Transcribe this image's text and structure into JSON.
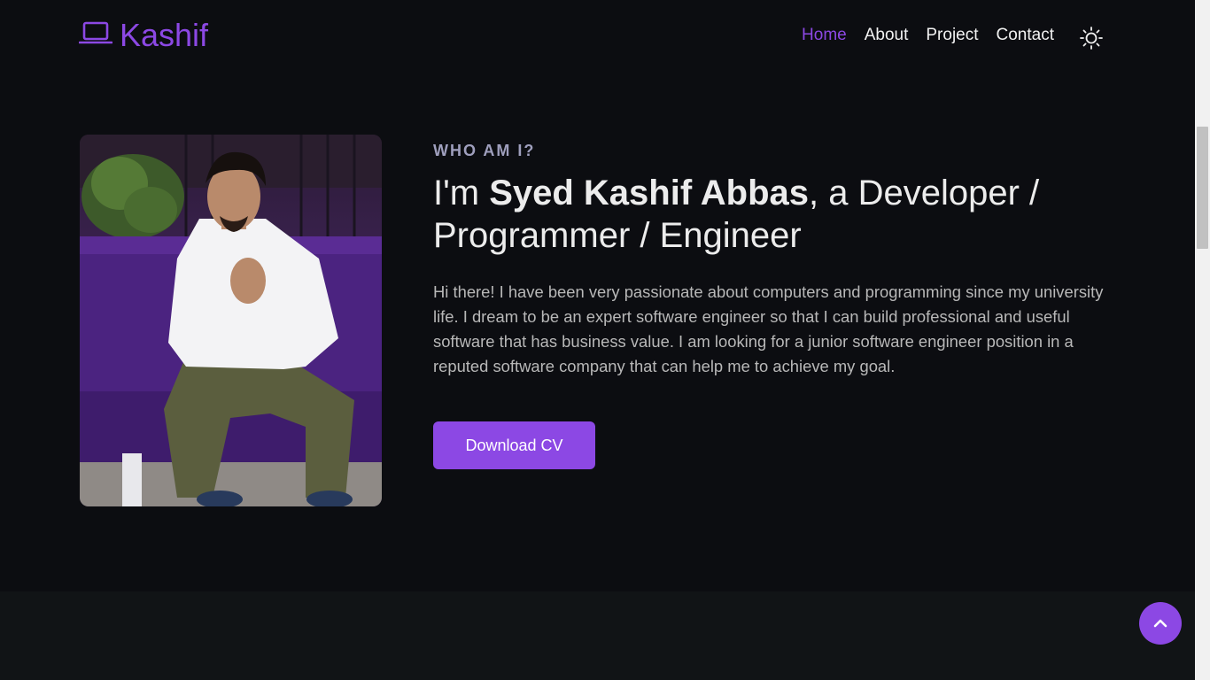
{
  "header": {
    "brand_icon": "laptop-icon",
    "brand_name": "Kashif",
    "nav_items": [
      {
        "label": "Home",
        "active": true
      },
      {
        "label": "About",
        "active": false
      },
      {
        "label": "Project",
        "active": false
      },
      {
        "label": "Contact",
        "active": false
      }
    ],
    "theme_toggle_icon": "sun-icon"
  },
  "hero": {
    "photo_alt": "profile-photo",
    "eyebrow": "WHO AM I?",
    "headline_prefix": "I'm ",
    "headline_name": "Syed Kashif Abbas",
    "headline_suffix": ", a Developer / Programmer / Engineer",
    "intro": "Hi there! I have been very passionate about computers and programming since my university life. I dream to be an expert software engineer so that I can build professional and useful software that has business value. I am looking for a junior software engineer position in a reputed software company that can help me to achieve my goal.",
    "cta_label": "Download CV"
  },
  "back_to_top_icon": "chevron-up-icon",
  "colors": {
    "accent": "#8c48e4",
    "background": "#0c0d11",
    "section_background": "#111416",
    "text": "#ececec",
    "muted_text": "#b8b8b8",
    "eyebrow": "#9f9fbd"
  }
}
